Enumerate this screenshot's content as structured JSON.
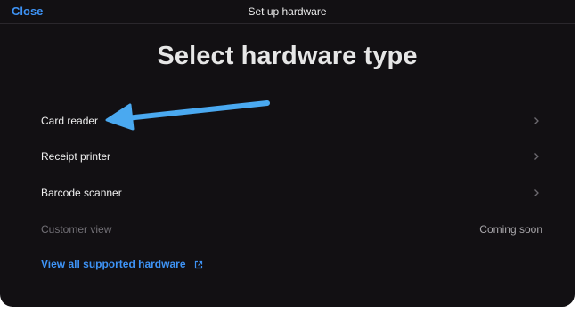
{
  "header": {
    "close_label": "Close",
    "title": "Set up hardware"
  },
  "main": {
    "heading": "Select hardware type",
    "items": [
      {
        "label": "Card reader",
        "icon": "chevron-right-icon"
      },
      {
        "label": "Receipt printer",
        "icon": "chevron-right-icon"
      },
      {
        "label": "Barcode scanner",
        "icon": "chevron-right-icon"
      },
      {
        "label": "Customer view",
        "status": "Coming soon",
        "disabled": true
      }
    ],
    "link": {
      "label": "View all supported hardware",
      "icon": "external-link-icon"
    }
  },
  "annotation": {
    "icon": "arrow-annotation",
    "color": "#4aa9f0"
  },
  "colors": {
    "background": "#121013",
    "accent": "#3e93f5",
    "text": "#f1f1f1",
    "muted": "#727076"
  }
}
